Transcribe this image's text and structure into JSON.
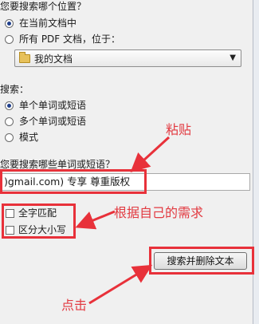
{
  "location": {
    "heading": "您要搜索哪个位置？",
    "options": [
      "在当前文档中",
      "所有 PDF 文档，位于："
    ],
    "selected_index": 0,
    "folder_value": "我的文档"
  },
  "search_mode": {
    "heading": "搜索：",
    "options": [
      "单个单词或短语",
      "多个单词或短语",
      "模式"
    ],
    "selected_index": 0
  },
  "query": {
    "heading": "您要搜索哪些单词或短语？",
    "value": ")gmail.com) 专享 尊重版权"
  },
  "checkboxes": [
    {
      "label": "全字匹配",
      "checked": false
    },
    {
      "label": "区分大小写",
      "checked": false
    }
  ],
  "search_button_label": "搜索并删除文本",
  "annotations": {
    "paste": "粘贴",
    "needs": "根据自己的需求",
    "click": "点击"
  },
  "colors": {
    "annotation_red": "#e8313a",
    "selected_radio": "#1f3f8c"
  }
}
